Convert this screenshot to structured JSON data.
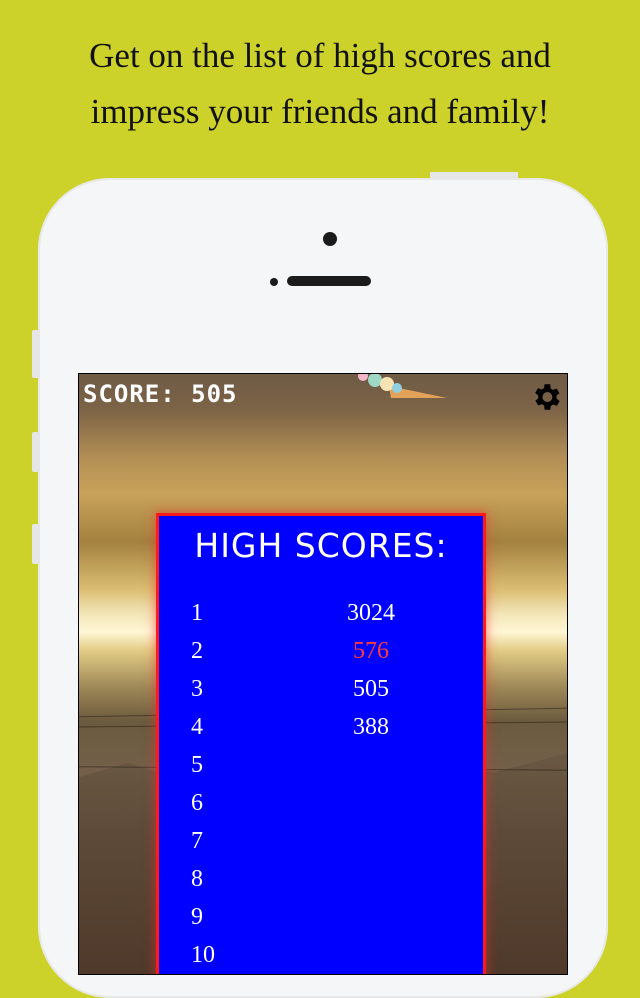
{
  "promo": {
    "line1": "Get on the list of high scores and",
    "line2": "impress your friends and family!"
  },
  "game": {
    "score_label": "SCORE: 505",
    "settings_icon": "gear-icon",
    "collectible_icon": "ice-cream-cone-icon",
    "high_scores": {
      "title": "HIGH SCORES:",
      "rows": [
        {
          "rank": "1",
          "score": "3024",
          "color": "#ffffff"
        },
        {
          "rank": "2",
          "score": "576",
          "color": "#ff3b3b"
        },
        {
          "rank": "3",
          "score": "505",
          "color": "#ffffff"
        },
        {
          "rank": "4",
          "score": "388",
          "color": "#ffffff"
        },
        {
          "rank": "5",
          "score": "",
          "color": "#ffffff"
        },
        {
          "rank": "6",
          "score": "",
          "color": "#ffffff"
        },
        {
          "rank": "7",
          "score": "",
          "color": "#ffffff"
        },
        {
          "rank": "8",
          "score": "",
          "color": "#ffffff"
        },
        {
          "rank": "9",
          "score": "",
          "color": "#ffffff"
        },
        {
          "rank": "10",
          "score": "",
          "color": "#ffffff"
        }
      ]
    }
  },
  "colors": {
    "background": "#cdd22a",
    "panel": "#0000ff",
    "panel_border": "#ff1a1a",
    "highlight_score": "#ff3b3b"
  }
}
